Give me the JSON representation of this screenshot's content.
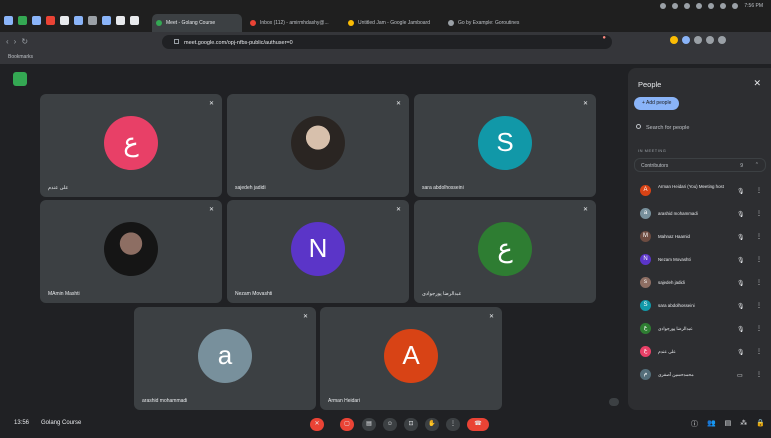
{
  "browser": {
    "tabs": [
      {
        "label": "Meet - Golang Course",
        "active": true,
        "icon_color": "#34a853"
      },
      {
        "label": "Inbox (112) - amirmhdashy@...",
        "active": false,
        "icon_color": "#ea4335"
      },
      {
        "label": "Untitled Jam - Google Jamboard",
        "active": false,
        "icon_color": "#fbbc04"
      },
      {
        "label": "Go by Example: Goroutines",
        "active": false,
        "icon_color": "#9aa0a6"
      }
    ],
    "url": "meet.google.com/opj-nfbs-public/authuser=0",
    "tray_time": "7:56 PM",
    "bookmark_label": "Bookmarks"
  },
  "meeting": {
    "time": "13:56",
    "name": "Golang Course"
  },
  "tiles": [
    {
      "name": "علی عندم",
      "avatar_letter": "ع",
      "avatar_color": "#e84067",
      "photo": false
    },
    {
      "name": "sajedeh jadidi",
      "avatar_letter": "",
      "avatar_color": "",
      "photo": true
    },
    {
      "name": "sara abdolhosseini",
      "avatar_letter": "S",
      "avatar_color": "#1198a8",
      "photo": false
    },
    {
      "name": "MAmin Mashti",
      "avatar_letter": "",
      "avatar_color": "",
      "photo": true
    },
    {
      "name": "Nezam Movashti",
      "avatar_letter": "N",
      "avatar_color": "#5b35c8",
      "photo": false
    },
    {
      "name": "عبدالرضا پورجوادی",
      "avatar_letter": "ع",
      "avatar_color": "#2e7d32",
      "photo": false
    },
    {
      "name": "arashid mohammadi",
      "avatar_letter": "a",
      "avatar_color": "#78909c",
      "photo": false
    },
    {
      "name": "Arman Heidari",
      "avatar_letter": "A",
      "avatar_color": "#d84315",
      "photo": false
    }
  ],
  "people_panel": {
    "title": "People",
    "close_icon": "close-icon",
    "add_people_label": "Add people",
    "search_placeholder": "Search for people",
    "section_label": "IN MEETING",
    "group_label": "Contributors",
    "group_count": "9",
    "participants": [
      {
        "name": "Arman Heidari (You) Meeting host",
        "avatar_letter": "A",
        "avatar_color": "#d84315",
        "two_line": true
      },
      {
        "name": "arashid mohammadi",
        "avatar_letter": "a",
        "avatar_color": "#78909c",
        "two_line": false
      },
      {
        "name": "Mahnaz Haamid",
        "avatar_letter": "M",
        "avatar_color": "#6d4c41",
        "two_line": false
      },
      {
        "name": "Nezam Movashti",
        "avatar_letter": "N",
        "avatar_color": "#5b35c8",
        "two_line": false
      },
      {
        "name": "sajedeh jadidi",
        "avatar_letter": "s",
        "avatar_color": "#8d6e63",
        "two_line": false
      },
      {
        "name": "sara abdolhosseini",
        "avatar_letter": "S",
        "avatar_color": "#1198a8",
        "two_line": false
      },
      {
        "name": "عبدالرضا پورجوادی",
        "avatar_letter": "ع",
        "avatar_color": "#2e7d32",
        "two_line": false
      },
      {
        "name": "علی عندم",
        "avatar_letter": "ع",
        "avatar_color": "#e84067",
        "two_line": false
      },
      {
        "name": "محمدحسین آصفری",
        "avatar_letter": "م",
        "avatar_color": "#546e7a",
        "two_line": false
      }
    ]
  }
}
